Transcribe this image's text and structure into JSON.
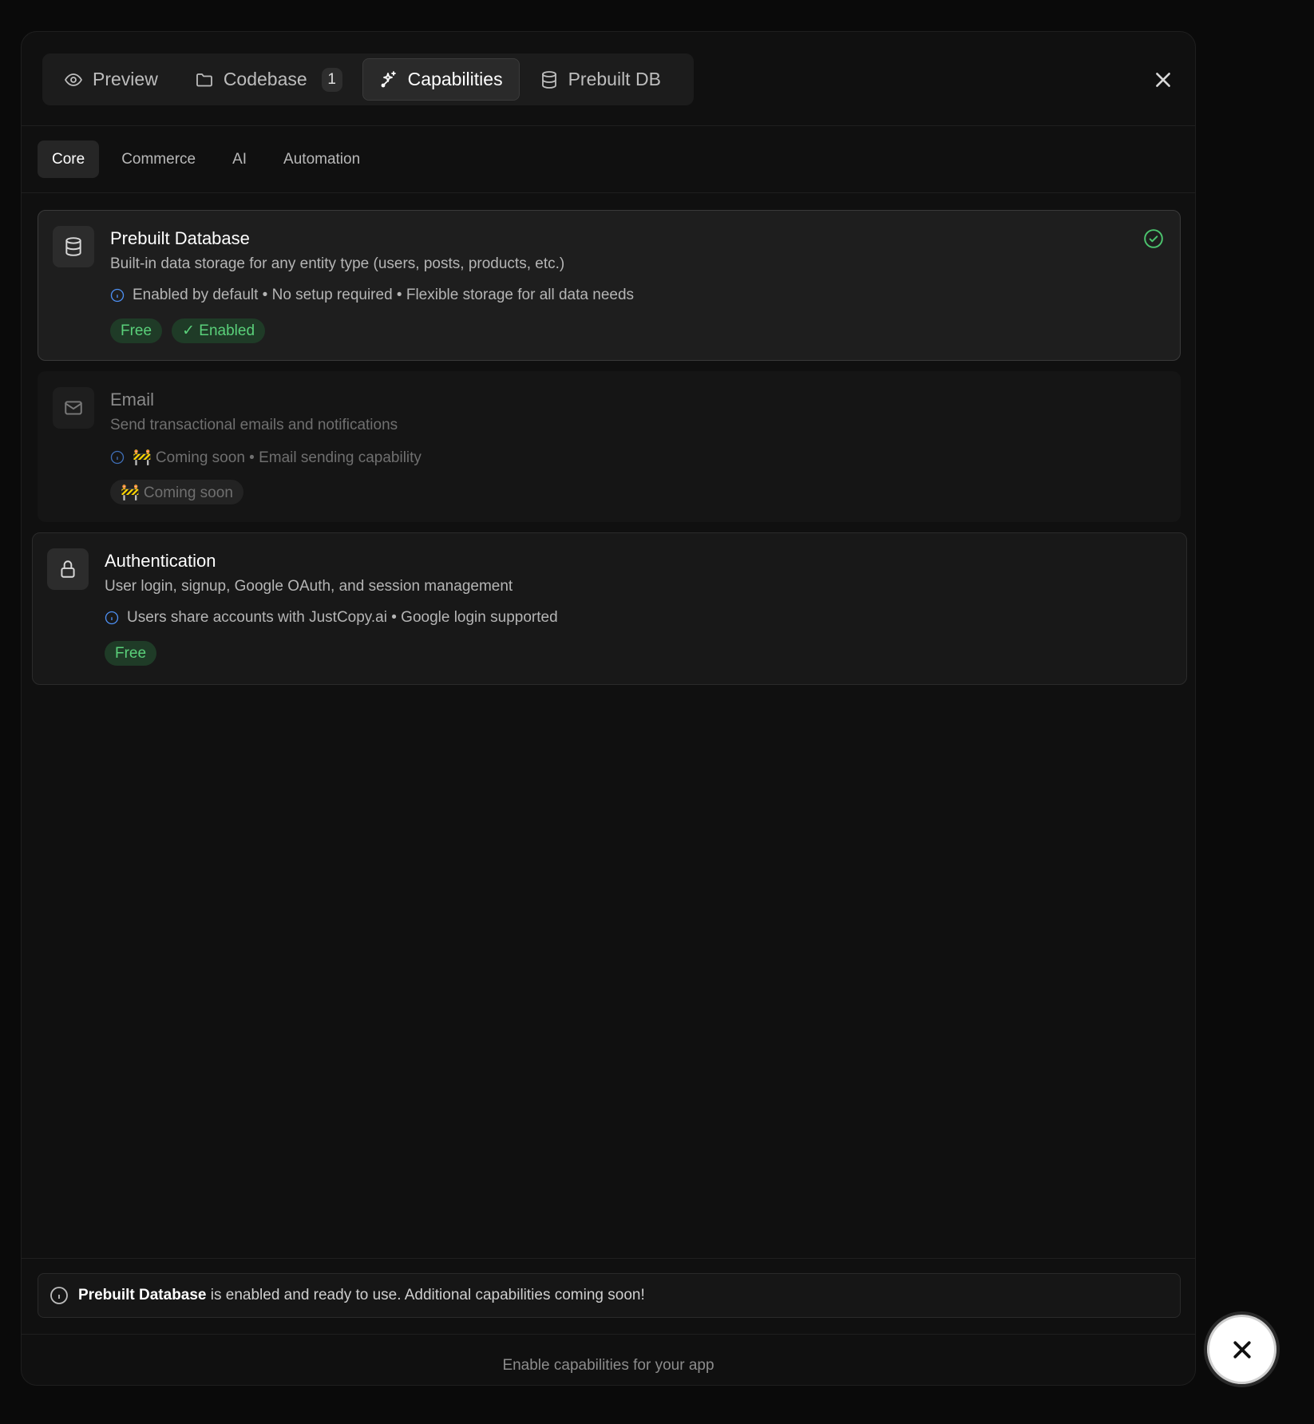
{
  "top_tabs": [
    {
      "label": "Preview",
      "icon": "eye-icon"
    },
    {
      "label": "Codebase",
      "icon": "folder-icon",
      "badge": "1"
    },
    {
      "label": "Capabilities",
      "icon": "sparkles-icon",
      "active": true
    },
    {
      "label": "Prebuilt DB",
      "icon": "database-icon"
    }
  ],
  "sub_tabs": [
    {
      "label": "Core",
      "active": true
    },
    {
      "label": "Commerce"
    },
    {
      "label": "AI"
    },
    {
      "label": "Automation"
    }
  ],
  "cards": [
    {
      "title": "Prebuilt Database",
      "description": "Built-in data storage for any entity type (users, posts, products, etc.)",
      "note": "Enabled by default • No setup required • Flexible storage for all data needs",
      "badges": [
        "Free",
        "✓ Enabled"
      ],
      "icon": "database-icon",
      "status": "enabled"
    },
    {
      "title": "Email",
      "description": "Send transactional emails and notifications",
      "note": "🚧 Coming soon • Email sending capability",
      "badges": [
        "🚧 Coming soon"
      ],
      "icon": "mail-icon",
      "status": "disabled"
    },
    {
      "title": "Authentication",
      "description": "User login, signup, Google OAuth, and session management",
      "note": "Users share accounts with JustCopy.ai • Google login supported",
      "badges": [
        "Free"
      ],
      "icon": "lock-icon",
      "status": "available"
    }
  ],
  "info_bar": {
    "bold": "Prebuilt Database",
    "text": " is enabled and ready to use. Additional capabilities coming soon!"
  },
  "footer_text": "Enable capabilities for your app",
  "colors": {
    "accent_green": "#5ad07a",
    "info_blue": "#4d8ff2",
    "background": "#101010"
  }
}
